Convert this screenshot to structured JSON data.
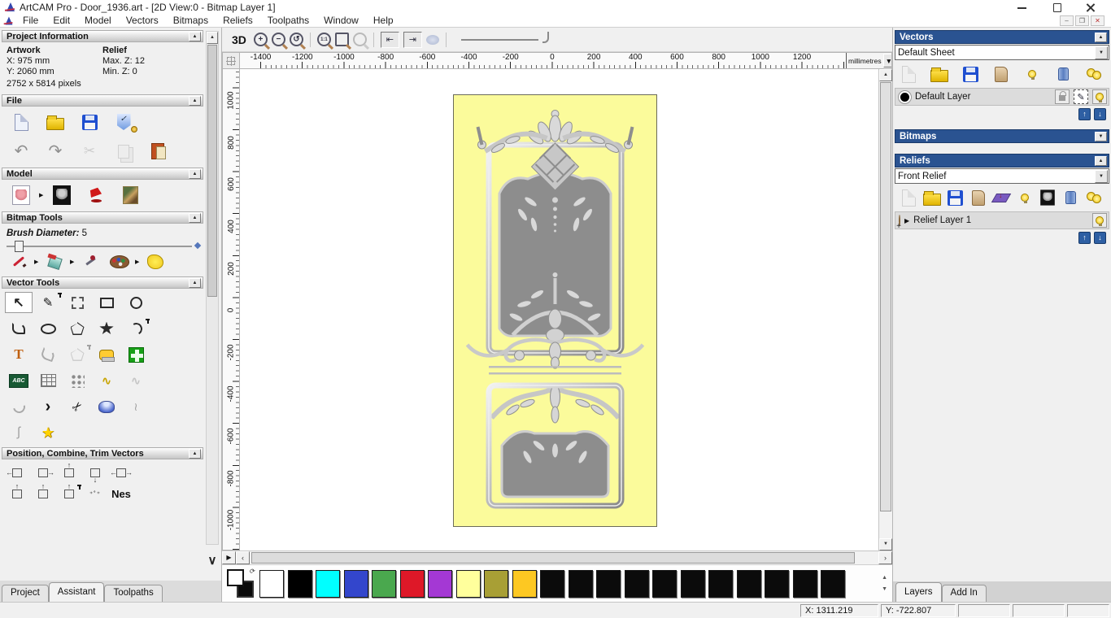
{
  "theme": {
    "header-blue": "#2a5391",
    "updown-blue": "#2e5fa3",
    "door-bg": "#fbfb9b",
    "door-panel": "#8d8d8d",
    "door-frame": "#b9b9b9",
    "door-ornament": "#d9d9d9"
  },
  "window": {
    "title": "ArtCAM Pro - Door_1936.art - [2D View:0 - Bitmap Layer 1]"
  },
  "menu": {
    "items": [
      "File",
      "Edit",
      "Model",
      "Vectors",
      "Bitmaps",
      "Reliefs",
      "Toolpaths",
      "Window",
      "Help"
    ]
  },
  "left_panel": {
    "project_information": {
      "title": "Project Information",
      "artwork_label": "Artwork",
      "relief_label": "Relief",
      "artwork_x": "X: 975 mm",
      "artwork_y": "Y: 2060 mm",
      "artwork_pixels": "2752 x 5814 pixels",
      "relief_max_z": "Max. Z: 12",
      "relief_min_z": "Min. Z: 0"
    },
    "file_title": "File",
    "model_title": "Model",
    "bitmap_tools_title": "Bitmap Tools",
    "brush_diameter_label": "Brush Diameter:",
    "brush_diameter_value": "5",
    "vector_tools_title": "Vector Tools",
    "position_title": "Position, Combine, Trim Vectors",
    "nest_label": "Nes",
    "abc_icon_label": "ABC",
    "tabs": {
      "project": "Project",
      "assistant": "Assistant",
      "toolpaths": "Toolpaths"
    }
  },
  "toolbar": {
    "view_3d_label": "3D"
  },
  "canvas": {
    "ruler_h": [
      "-1400",
      "-1200",
      "-1000",
      "-800",
      "-600",
      "-400",
      "-200",
      "0",
      "200",
      "400",
      "600",
      "800",
      "1000",
      "1200"
    ],
    "ruler_units": "millimetres",
    "ruler_v": [
      "1000",
      "800",
      "600",
      "400",
      "200",
      "0",
      "-200",
      "-400",
      "-600",
      "-800",
      "-1000"
    ]
  },
  "right_panel": {
    "vectors": {
      "title": "Vectors",
      "sheet_value": "Default Sheet",
      "layer_name": "Default Layer"
    },
    "bitmaps": {
      "title": "Bitmaps"
    },
    "reliefs": {
      "title": "Reliefs",
      "relief_value": "Front Relief",
      "layer_name": "Relief Layer 1"
    },
    "tabs": {
      "layers": "Layers",
      "add_in": "Add In"
    }
  },
  "palette": {
    "colors": [
      "#ffffff",
      "#000000",
      "#00ffff",
      "#3346cc",
      "#4aa84e",
      "#de1828",
      "#a438d4",
      "#ffff9c",
      "#a89f35",
      "#fdc822",
      "#0b0b0b",
      "#0b0b0b",
      "#0b0b0b",
      "#0b0b0b",
      "#0b0b0b",
      "#0b0b0b",
      "#0b0b0b",
      "#0b0b0b",
      "#0b0b0b",
      "#0b0b0b",
      "#0b0b0b"
    ]
  },
  "status_bar": {
    "x": "X: 1311.219",
    "y": "Y: -722.807"
  },
  "icons": {
    "undo": "↶",
    "redo": "↷",
    "cut": "✂",
    "select_arrow": "↖",
    "node_edit": "✎",
    "text_tool": "T",
    "arrow_tool": "›",
    "trim": "✂",
    "star": "★",
    "profile": "ʃ",
    "bezier": "≀",
    "zigzag": "∿",
    "up": "↑",
    "down": "↓",
    "left": "←",
    "right": "→",
    "collapse": "▲",
    "expand": "▼",
    "play": "▶",
    "scroll_left": "‹",
    "scroll_right": "›",
    "chevron_down": "∨",
    "plus": "+",
    "minus": "−",
    "reset_zoom": "↺",
    "panel_left": "⇤",
    "panel_right": "⇥"
  }
}
